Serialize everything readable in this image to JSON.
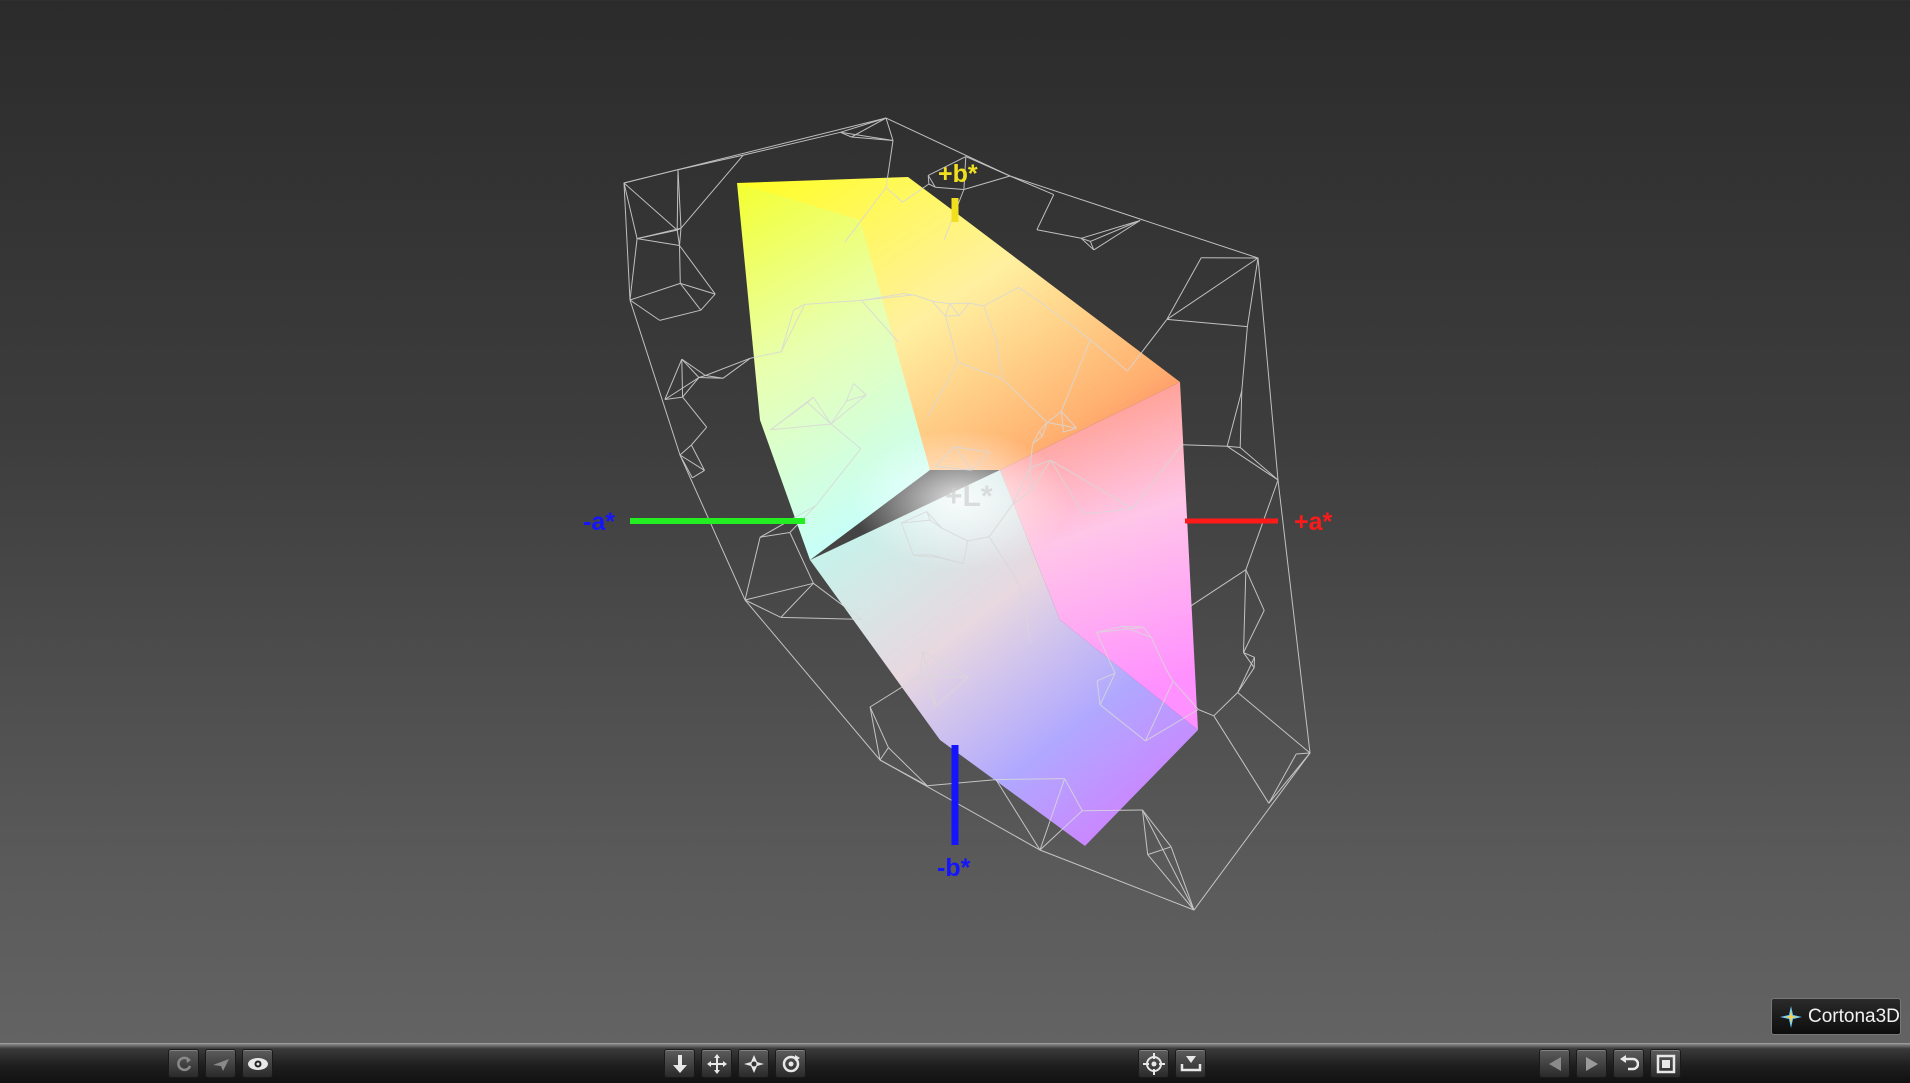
{
  "viewer": {
    "axes": {
      "plus_b": "+b*",
      "minus_b": "-b*",
      "plus_a": "+a*",
      "minus_a": "-a*",
      "plus_l": "+L*"
    },
    "colors": {
      "plus_b_axis": "#f0e020",
      "minus_b_axis": "#1414ff",
      "plus_a_axis": "#ff1a1a",
      "minus_a_axis": "#22ee22",
      "wireframe": "#d8d8d8"
    }
  },
  "logo": {
    "brand": "Cortona3D"
  },
  "toolbar": {
    "left_buttons": [
      "refresh-icon",
      "fly-icon",
      "eye-icon"
    ],
    "center_buttons": [
      "move-down-icon",
      "pan-icon",
      "walk-icon",
      "rotate-icon"
    ],
    "tools_buttons": [
      "target-icon",
      "ground-icon"
    ],
    "right_buttons": [
      "prev-viewpoint-icon",
      "next-viewpoint-icon",
      "restore-icon",
      "fit-icon"
    ]
  }
}
